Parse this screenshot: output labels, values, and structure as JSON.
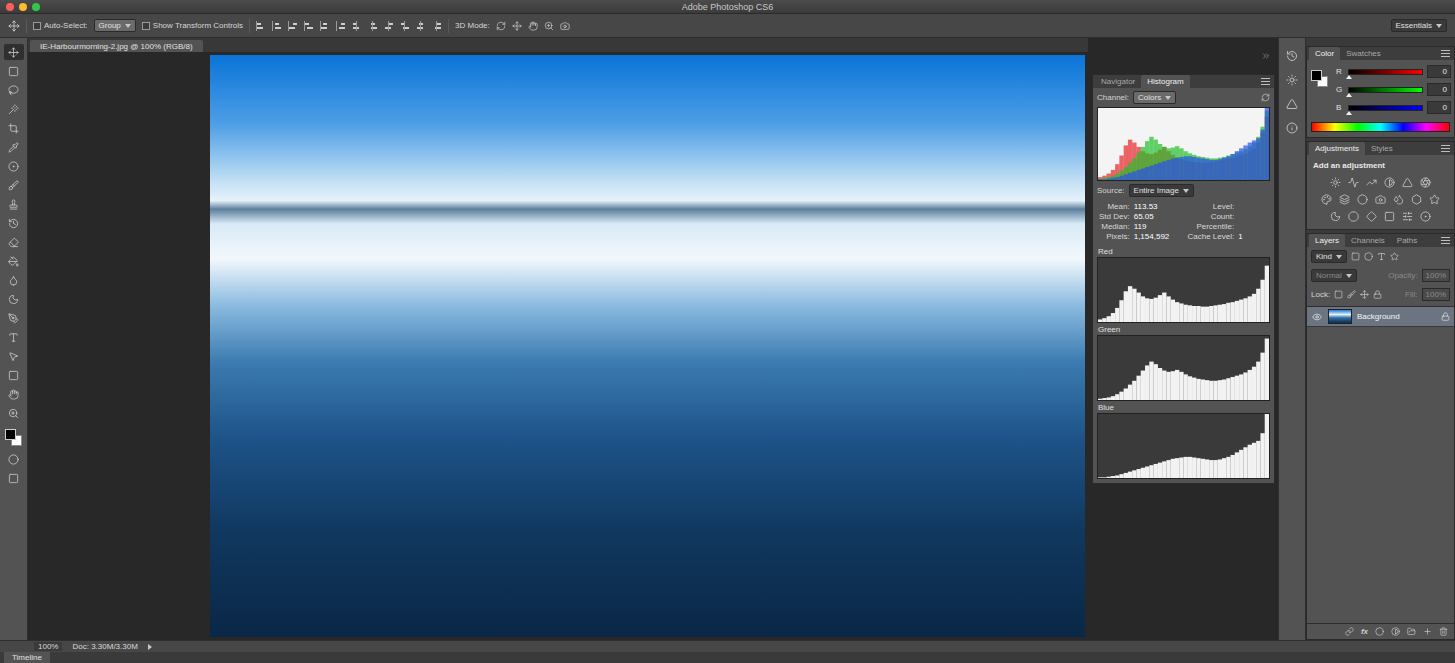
{
  "window": {
    "title": "Adobe Photoshop CS6",
    "controls": [
      {
        "name": "close",
        "color": "#fc5f57"
      },
      {
        "name": "minimize",
        "color": "#fdbc2e"
      },
      {
        "name": "zoom",
        "color": "#33c748"
      }
    ]
  },
  "options_bar": {
    "auto_select": {
      "label": "Auto-Select:",
      "checked": false
    },
    "auto_select_target": "Group",
    "transform_controls": {
      "label": "Show Transform Controls",
      "checked": false
    },
    "mode_label": "3D Mode:",
    "workspace": "Essentials"
  },
  "document": {
    "tab": "IE-Harbourmorning-2.jpg @ 100% (RGB/8)"
  },
  "toolbar": {
    "tools": [
      {
        "selected": true
      },
      {
        "selected": false
      },
      {
        "selected": false
      },
      {
        "selected": false
      },
      {
        "selected": false
      },
      {
        "selected": false
      },
      {
        "selected": false
      },
      {
        "selected": false
      },
      {
        "selected": false
      },
      {
        "selected": false
      },
      {
        "selected": false
      },
      {
        "selected": false
      },
      {
        "selected": false
      },
      {
        "selected": false
      },
      {
        "selected": false
      },
      {
        "selected": false
      },
      {
        "selected": false
      },
      {
        "selected": false
      },
      {
        "selected": false
      },
      {
        "selected": false
      }
    ]
  },
  "histogram": {
    "tabs": [
      {
        "label": "Navigator",
        "selected": false
      },
      {
        "label": "Histogram",
        "selected": true
      }
    ],
    "channel_label": "Channel:",
    "channel": "Colors",
    "source_label": "Source:",
    "source": "Entire Image",
    "stats": [
      {
        "label": "Mean:",
        "value": "113.53"
      },
      {
        "label": "Std Dev:",
        "value": "65.05"
      },
      {
        "label": "Median:",
        "value": "119"
      },
      {
        "label": "Pixels:",
        "value": "1,154,592"
      }
    ],
    "stats_right": [
      {
        "label": "Level:",
        "value": ""
      },
      {
        "label": "Count:",
        "value": ""
      },
      {
        "label": "Percentile:",
        "value": ""
      },
      {
        "label": "Cache Level:",
        "value": "1"
      }
    ],
    "channels": [
      {
        "name": "Red",
        "color": "#e5262a",
        "values": [
          4,
          6,
          9,
          14,
          22,
          34,
          48,
          56,
          52,
          46,
          40,
          37,
          36,
          38,
          42,
          46,
          40,
          35,
          31,
          29,
          27,
          26,
          25,
          25,
          24,
          24,
          25,
          26,
          27,
          28,
          30,
          31,
          33,
          35,
          37,
          40,
          44,
          52,
          66,
          88
        ]
      },
      {
        "name": "Green",
        "color": "#21c02a",
        "values": [
          2,
          3,
          4,
          6,
          9,
          13,
          18,
          24,
          30,
          38,
          46,
          54,
          60,
          56,
          50,
          46,
          44,
          45,
          47,
          44,
          40,
          37,
          35,
          33,
          32,
          31,
          30,
          30,
          31,
          32,
          34,
          36,
          38,
          40,
          43,
          47,
          52,
          60,
          74,
          96
        ]
      },
      {
        "name": "Blue",
        "color": "#2a4ff0",
        "values": [
          1,
          1,
          2,
          3,
          4,
          6,
          8,
          10,
          12,
          14,
          16,
          18,
          20,
          22,
          24,
          26,
          28,
          30,
          31,
          32,
          33,
          33,
          32,
          31,
          30,
          29,
          28,
          28,
          29,
          31,
          33,
          36,
          40,
          44,
          48,
          52,
          55,
          58,
          70,
          100
        ]
      }
    ]
  },
  "color_panel": {
    "tabs": [
      {
        "label": "Color",
        "selected": true
      },
      {
        "label": "Swatches",
        "selected": false
      }
    ],
    "sliders": [
      {
        "label": "R",
        "value": "0",
        "level": 0,
        "color": "#ff0000"
      },
      {
        "label": "G",
        "value": "0",
        "level": 0,
        "color": "#00ff00"
      },
      {
        "label": "B",
        "value": "0",
        "level": 0,
        "color": "#0000ff"
      }
    ]
  },
  "adjustments_panel": {
    "tabs": [
      {
        "label": "Adjustments",
        "selected": true
      },
      {
        "label": "Styles",
        "selected": false
      }
    ],
    "hint": "Add an adjustment"
  },
  "layers_panel": {
    "tabs": [
      {
        "label": "Layers",
        "selected": true
      },
      {
        "label": "Channels",
        "selected": false
      },
      {
        "label": "Paths",
        "selected": false
      }
    ],
    "filter": "Kind",
    "blend_mode": {
      "value": "Normal",
      "disabled": true
    },
    "opacity": {
      "label": "Opacity:",
      "value": "100%",
      "disabled": true
    },
    "lock_label": "Lock:",
    "fill": {
      "label": "Fill:",
      "value": "100%",
      "disabled": true
    },
    "layers": [
      {
        "name": "Background",
        "visible": true,
        "selected": true,
        "locked": true
      }
    ],
    "fx": "fx"
  },
  "status_bar": {
    "zoom": "100%",
    "doc_info": "Doc: 3.30M/3.30M"
  },
  "timeline": {
    "label": "Timeline"
  }
}
